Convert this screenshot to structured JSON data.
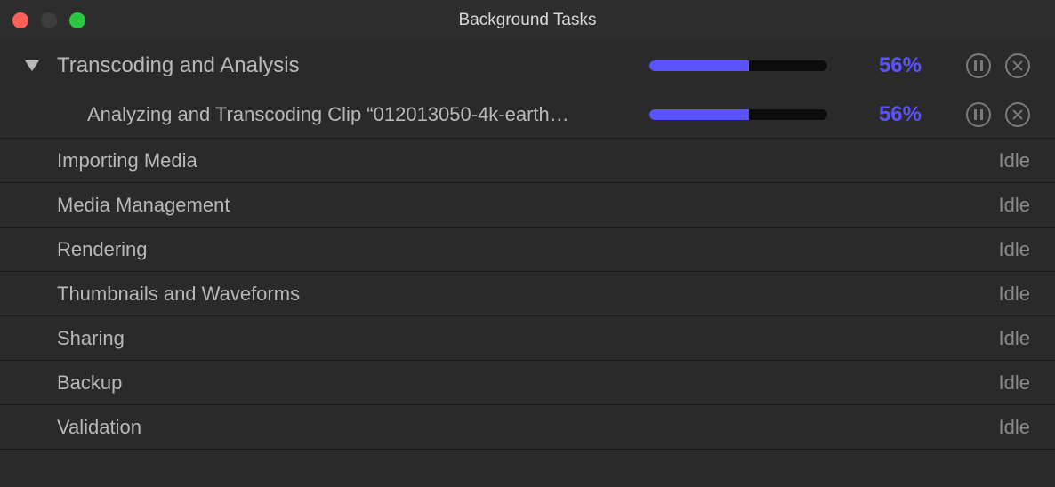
{
  "window": {
    "title": "Background Tasks"
  },
  "active": {
    "label": "Transcoding and Analysis",
    "progress": 56,
    "percent_label": "56%",
    "child": {
      "label": "Analyzing and Transcoding Clip “012013050-4k-earth…",
      "progress": 56,
      "percent_label": "56%"
    }
  },
  "idle_label": "Idle",
  "tasks": [
    {
      "label": "Importing Media",
      "status": "Idle"
    },
    {
      "label": "Media Management",
      "status": "Idle"
    },
    {
      "label": "Rendering",
      "status": "Idle"
    },
    {
      "label": "Thumbnails and Waveforms",
      "status": "Idle"
    },
    {
      "label": "Sharing",
      "status": "Idle"
    },
    {
      "label": "Backup",
      "status": "Idle"
    },
    {
      "label": "Validation",
      "status": "Idle"
    }
  ],
  "colors": {
    "accent": "#5b52ff"
  }
}
